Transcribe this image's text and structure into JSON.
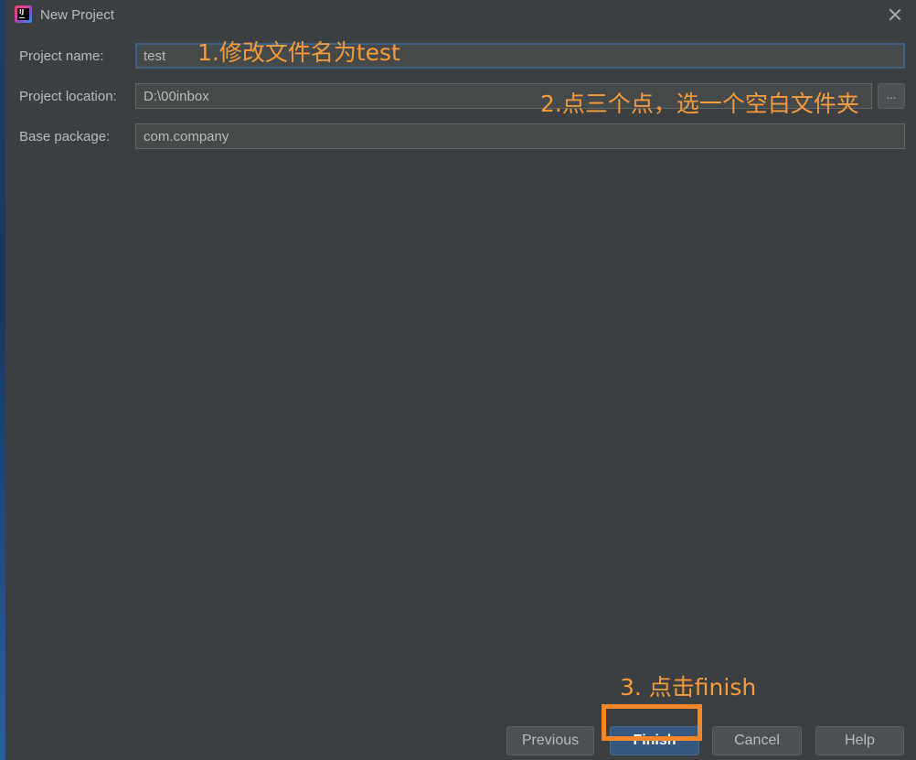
{
  "window": {
    "title": "New Project",
    "app_icon": "intellij-idea-icon",
    "close_icon": "close-icon"
  },
  "form": {
    "project_name": {
      "label": "Project name:",
      "value": "test"
    },
    "project_location": {
      "label": "Project location:",
      "value": "D:\\00inbox",
      "browse_label": "..."
    },
    "base_package": {
      "label": "Base package:",
      "value": "com.company"
    }
  },
  "annotations": {
    "step1": "1.修改文件名为test",
    "step2": "2.点三个点，选一个空白文件夹",
    "step3": "3. 点击finish"
  },
  "buttons": {
    "previous": "Previous",
    "finish": "Finish",
    "cancel": "Cancel",
    "help": "Help"
  },
  "colors": {
    "background": "#3c3f41",
    "annotation": "#f79b3c",
    "highlight_box": "#f7862b",
    "primary_button": "#365880"
  }
}
